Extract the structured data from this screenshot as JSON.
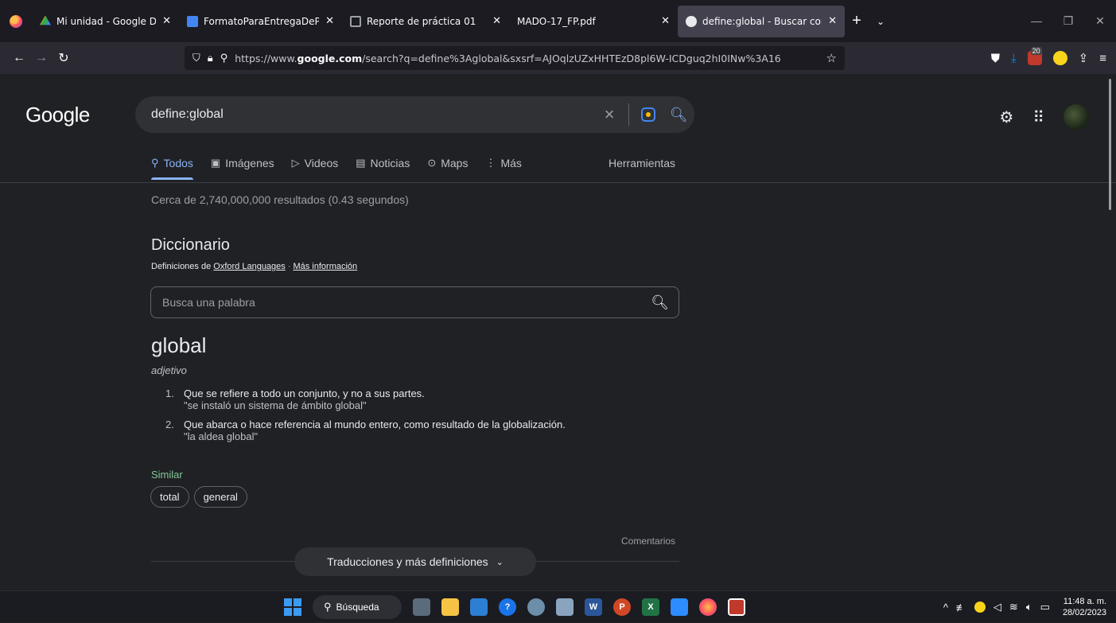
{
  "browser": {
    "tabs": [
      {
        "title": "Mi unidad - Google Drive",
        "favicon_color": "#34a853",
        "active": false
      },
      {
        "title": "FormatoParaEntregaDePráctica",
        "favicon_color": "#4285f4",
        "active": false
      },
      {
        "title": "Reporte de práctica 01",
        "favicon_color": "#9aa0a6",
        "active": false
      },
      {
        "title": "MADO-17_FP.pdf",
        "favicon_color": "#1c1b22",
        "active": false
      },
      {
        "title": "define:global - Buscar con Google",
        "favicon_color": "#e8eaed",
        "active": true
      }
    ],
    "url_prefix": "https://www.",
    "url_domain": "google.com",
    "url_rest": "/search?q=define%3Aglobal&sxsrf=AJOqlzUZxHHTEzD8pl6W-ICDguq2hI0INw%3A16",
    "download_badge": "20"
  },
  "google": {
    "logo": "Google",
    "query": "define:global",
    "tabs": [
      {
        "label": "Todos",
        "icon": "search-icon",
        "selected": true
      },
      {
        "label": "Imágenes",
        "icon": "image-icon",
        "selected": false
      },
      {
        "label": "Videos",
        "icon": "video-icon",
        "selected": false
      },
      {
        "label": "Noticias",
        "icon": "news-icon",
        "selected": false
      },
      {
        "label": "Maps",
        "icon": "map-pin-icon",
        "selected": false
      },
      {
        "label": "Más",
        "icon": "more-vert-icon",
        "selected": false
      }
    ],
    "tools": "Herramientas",
    "stats": "Cerca de 2,740,000,000 resultados (0.43 segundos)",
    "dictionary": {
      "title": "Diccionario",
      "sub_prefix": "Definiciones de",
      "source": "Oxford Languages",
      "more_info": "Más información",
      "search_placeholder": "Busca una palabra",
      "word": "global",
      "part_of_speech": "adjetivo",
      "definitions": [
        {
          "n": "1.",
          "text": "Que se refiere a todo un conjunto, y no a sus partes.",
          "example": "\"se instaló un sistema de ámbito global\""
        },
        {
          "n": "2.",
          "text": "Que abarca o hace referencia al mundo entero, como resultado de la globalización.",
          "example": "\"la aldea global\""
        }
      ],
      "similar_label": "Similar",
      "similar": [
        "total",
        "general"
      ],
      "feedback": "Comentarios",
      "more_button": "Traducciones y más definiciones"
    }
  },
  "taskbar": {
    "search_label": "Búsqueda",
    "time": "11:48 a. m.",
    "date": "28/02/2023"
  }
}
